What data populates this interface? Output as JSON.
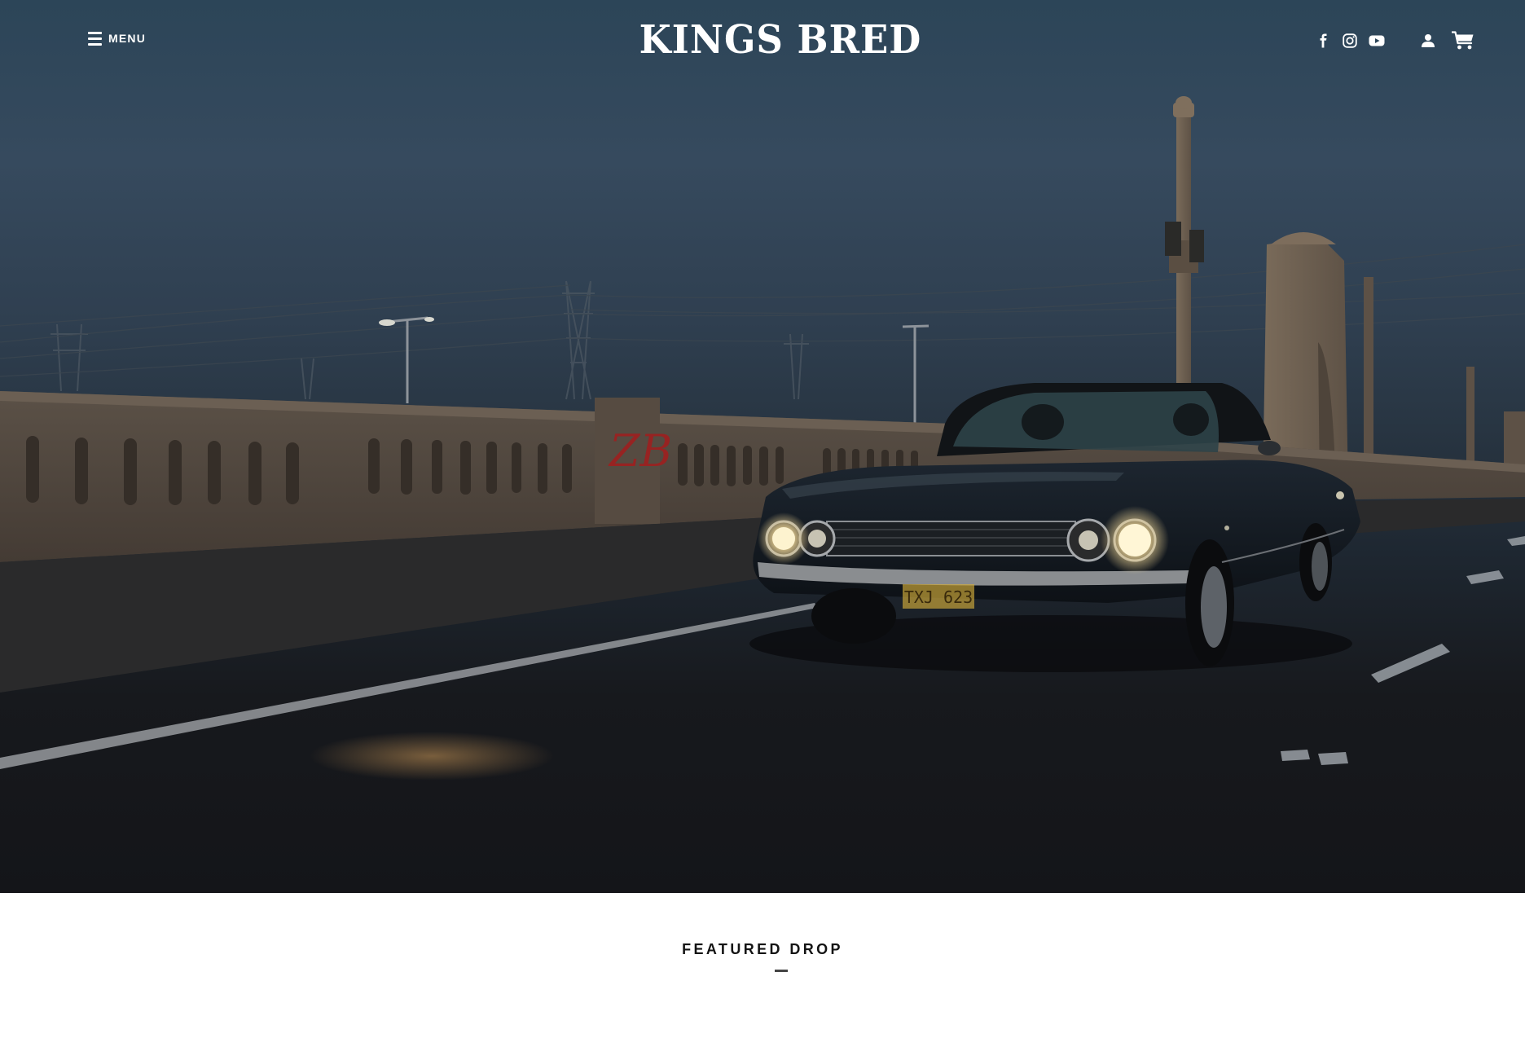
{
  "header": {
    "menu_label": "MENU",
    "logo_text": "KINGS BRED",
    "icons": {
      "menu": "hamburger-icon",
      "facebook": "facebook-icon",
      "instagram": "instagram-icon",
      "youtube": "youtube-icon",
      "account": "user-icon",
      "cart": "cart-icon"
    }
  },
  "hero": {
    "license_plate": "TXJ 623",
    "graffiti": "ZB"
  },
  "featured": {
    "title": "FEATURED DROP"
  },
  "colors": {
    "header_text": "#ffffff",
    "sky_top": "#2c4558",
    "road": "#17191d",
    "headlight": "#f4e2b0",
    "section_title": "#141414"
  }
}
